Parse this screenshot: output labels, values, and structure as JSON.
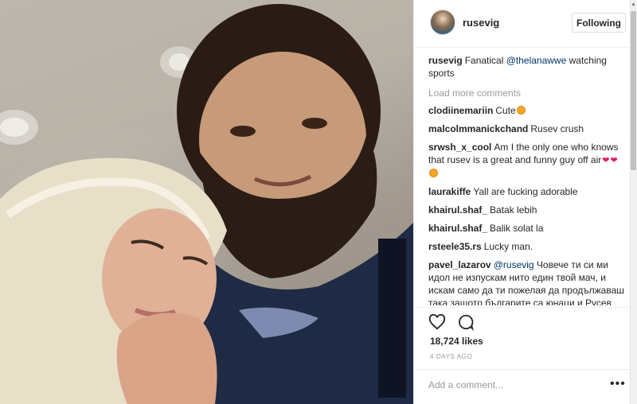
{
  "post": {
    "username": "rusevig",
    "follow_button": "Following"
  },
  "caption": {
    "username": "rusevig",
    "text_before": "Fanatical ",
    "mention": "@thelanawwe",
    "text_after": " watching sports"
  },
  "load_more": "Load more comments",
  "comments": [
    {
      "username": "clodiinemariin",
      "text": "Cute",
      "emoji": "smiling-face-emoji"
    },
    {
      "username": "malcolmmanickchand",
      "text": "Rusev crush"
    },
    {
      "username": "srwsh_x_cool",
      "text": "Am I the only one who knows that rusev is a great and funny guy off air",
      "emoji": "hearts-and-kiss-emoji"
    },
    {
      "username": "laurakiffe",
      "text": "Yall are fucking adorable"
    },
    {
      "username": "khairul.shaf_",
      "text": "Batak lebih"
    },
    {
      "username": "khairul.shaf_",
      "text": "Balik solat la"
    },
    {
      "username": "rsteele35.rs",
      "text": "Lucky man."
    },
    {
      "username": "pavel_lazarov",
      "mention": "@rusevig",
      "text": " Човече ти си ми идол не изпускам нито един твой мач, и искам само да ти пожелая да продължаваш така защото българите са юнаци и Русев"
    }
  ],
  "likes": "18,724 likes",
  "timestamp": "4 DAYS AGO",
  "add_comment": {
    "placeholder": "Add a comment..."
  },
  "more_icon": "ellipsis-icon",
  "colors": {
    "link": "#003569",
    "muted": "#999999",
    "text": "#262626",
    "border": "#efefef"
  }
}
